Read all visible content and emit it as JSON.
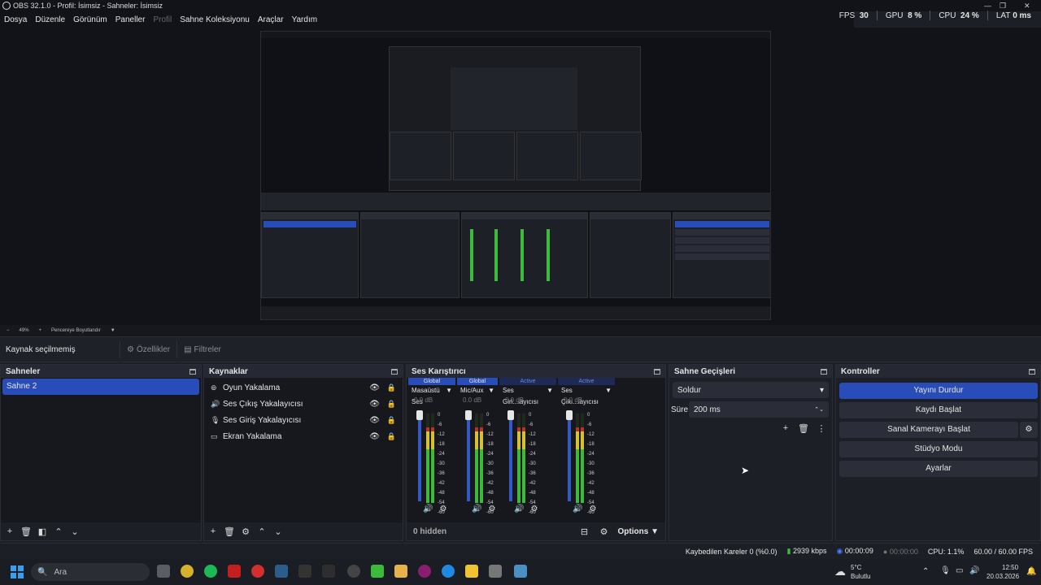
{
  "window": {
    "title": "OBS 32.1.0 - Profil: İsimsiz - Sahneler: İsimsiz",
    "controls": [
      "—",
      "❐",
      "✕"
    ]
  },
  "menu": [
    "Dosya",
    "Düzenle",
    "Görünüm",
    "Paneller",
    "Profil",
    "Sahne Koleksiyonu",
    "Araçlar",
    "Yardım"
  ],
  "stats": {
    "fps_label": "FPS",
    "fps_value": "30",
    "gpu_label": "GPU",
    "gpu_value": "8 %",
    "cpu_label": "CPU",
    "cpu_value": "24 %",
    "lat_label": "LAT",
    "lat_value": "0 ms"
  },
  "preview": {
    "zoom": "49%",
    "fit_label": "Pencereye Boyutlandır"
  },
  "source_toolbar": {
    "no_source": "Kaynak seçilmemiş",
    "properties": "Özellikler",
    "filters": "Filtreler"
  },
  "scenes": {
    "title": "Sahneler",
    "items": [
      "Sahne 2"
    ]
  },
  "sources": {
    "title": "Kaynaklar",
    "items": [
      {
        "icon": "gamepad-icon",
        "label": "Oyun Yakalama"
      },
      {
        "icon": "speaker-icon",
        "label": "Ses Çıkış Yakalayıcısı"
      },
      {
        "icon": "microphone-icon",
        "label": "Ses Giriş Yakalayıcısı"
      },
      {
        "icon": "monitor-icon",
        "label": "Ekran Yakalama"
      }
    ]
  },
  "mixer": {
    "title": "Ses Karıştırıcı",
    "channels": [
      {
        "tag": "Global",
        "name": "Masaüstü Ses",
        "db": "0.0 dB",
        "level": 0.85
      },
      {
        "tag": "Global",
        "name": "Mic/Aux",
        "db": "0.0 dB",
        "level": 0.85
      },
      {
        "tag": "Active",
        "name": "Ses Giri...layıcısı",
        "db": "0.0 dB",
        "level": 0.85
      },
      {
        "tag": "Active",
        "name": "Ses Çıkı...layıcısı",
        "db": "0.0 dB",
        "level": 0.85
      }
    ],
    "scale": [
      "0",
      "-6",
      "-12",
      "-18",
      "-24",
      "-30",
      "-36",
      "-42",
      "-48",
      "-54",
      "-60"
    ],
    "hidden_label": "0 hidden",
    "options_label": "Options"
  },
  "transitions": {
    "title": "Sahne Geçişleri",
    "selected": "Soldur",
    "duration_label": "Süre",
    "duration_value": "200 ms"
  },
  "controls": {
    "title": "Kontroller",
    "stop_stream": "Yayını Durdur",
    "start_record": "Kaydı Başlat",
    "virtual_cam": "Sanal Kamerayı Başlat",
    "studio_mode": "Stüdyo Modu",
    "settings": "Ayarlar"
  },
  "status": {
    "dropped": "Kaybedilen Kareler 0 (%0.0)",
    "bitrate": "2939 kbps",
    "stream_time": "00:00:09",
    "record_time": "00:00:00",
    "cpu": "CPU: 1.1%",
    "fps": "60.00 / 60.00 FPS"
  },
  "taskbar": {
    "search_placeholder": "Ara",
    "weather_temp": "5°C",
    "weather_desc": "Bulutlu",
    "time": "12:50",
    "date": "20.03.2026"
  },
  "colors": {
    "accent": "#284cb8",
    "bg": "#1d1f26",
    "meter_green": "#3cba3c",
    "meter_yellow": "#d6c22c",
    "meter_red": "#b8322c"
  }
}
